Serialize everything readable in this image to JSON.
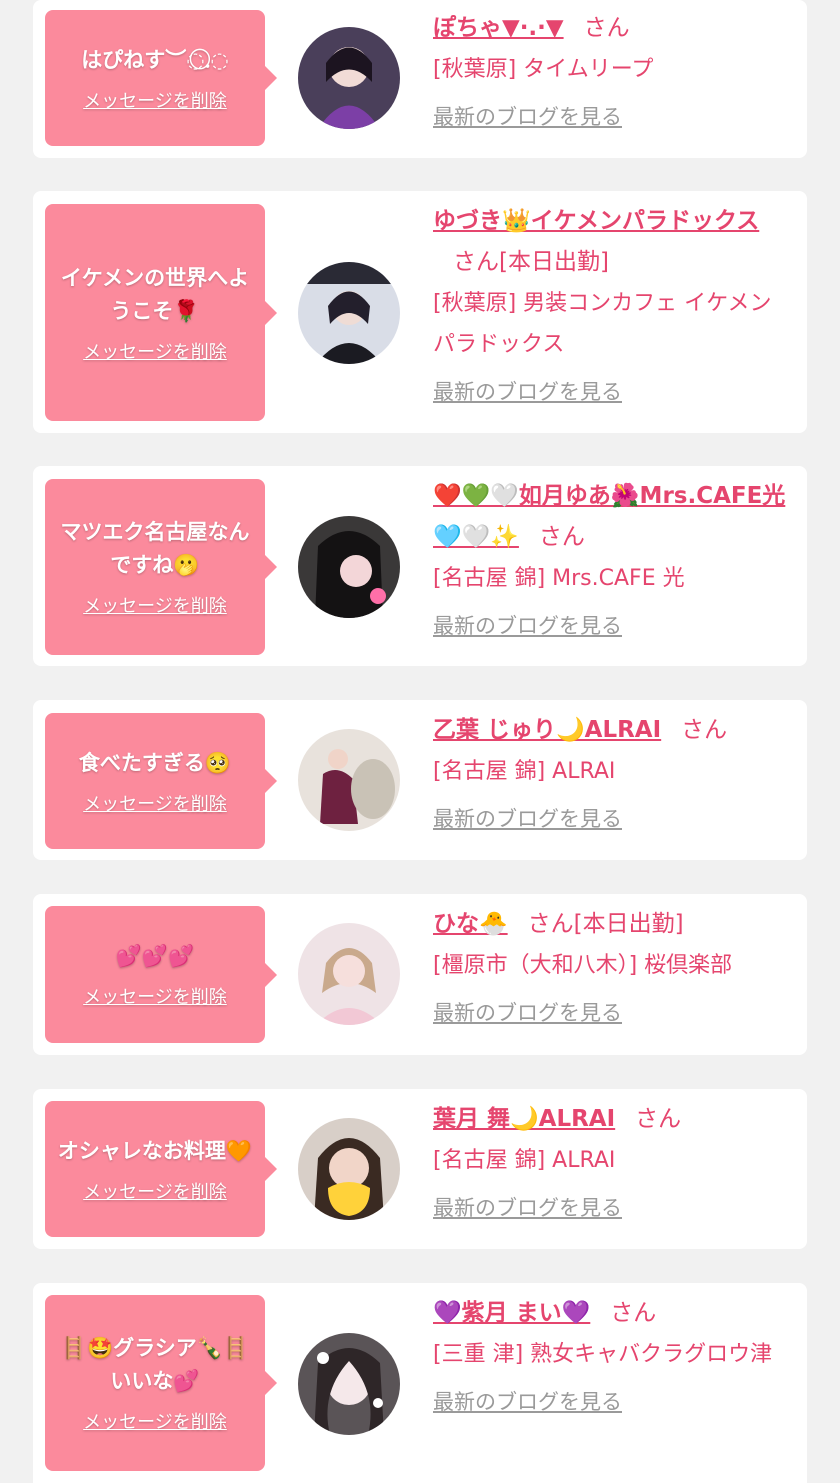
{
  "delete_label": "メッセージを削除",
  "blog_label": "最新のブログを見る",
  "san_label": "さん",
  "colors": {
    "bubble": "#fb8a9c",
    "name": "#e5456e",
    "link_gray": "#9a9a9a",
    "background": "#f1f1f1"
  },
  "messages": [
    {
      "text": "はぴねす︶◌.⃝◌",
      "name": "ぽちゃ▼·.·▼",
      "san_extra": "",
      "shop": "[秋葉原] タイムリープ"
    },
    {
      "text": "イケメンの世界へようこそ🌹",
      "name": "ゆづき👑イケメンパラドックス",
      "san_extra": "[本日出勤]",
      "shop": "[秋葉原] 男装コンカフェ イケメンパラドックス"
    },
    {
      "text": "マツエク名古屋なんですね🫢",
      "name": "❤️💚🤍如月ゆあ🌺Mrs.CAFE光🩵🤍✨",
      "san_extra": "",
      "shop": "[名古屋 錦] Mrs.CAFE 光"
    },
    {
      "text": "食べたすぎる🥺",
      "name": "乙葉 じゅり🌙ALRAI",
      "san_extra": "",
      "shop": "[名古屋 錦] ALRAI"
    },
    {
      "text": "💕💕💕",
      "name": "ひな🐣",
      "san_extra": "[本日出勤]",
      "shop": "[橿原市（大和八木）] 桜倶楽部"
    },
    {
      "text": "オシャレなお料理🧡",
      "name": "葉月 舞🌙ALRAI",
      "san_extra": "",
      "shop": "[名古屋 錦] ALRAI"
    },
    {
      "text": "🪜🤩グラシア🍾🪜いいな💕",
      "name": "💜紫月 まい💜",
      "san_extra": "",
      "shop": "[三重 津] 熟女キャバクラグロウ津"
    }
  ]
}
